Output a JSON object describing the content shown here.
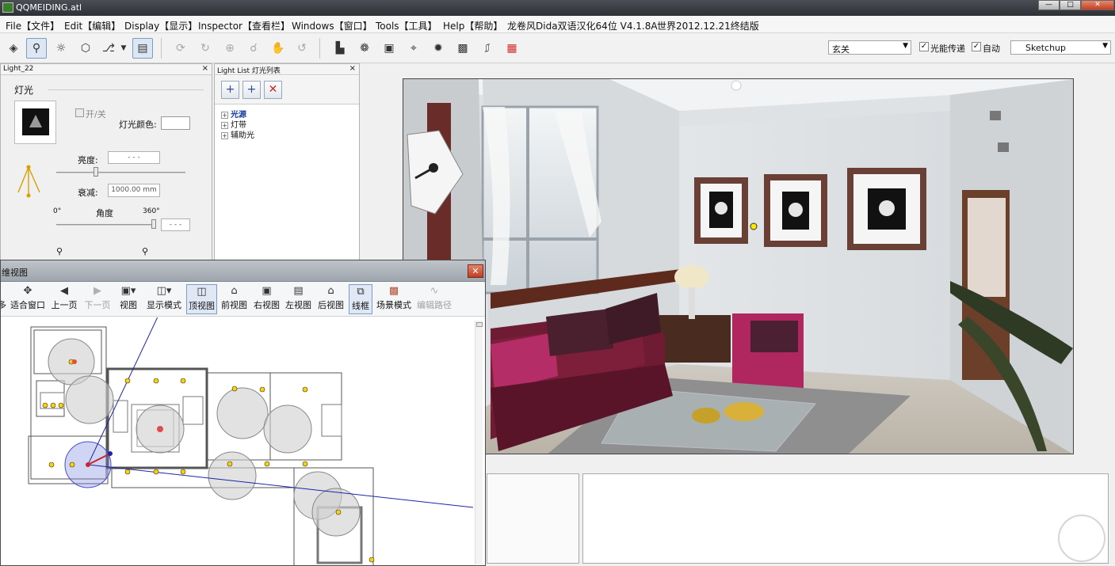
{
  "window": {
    "title": "QQMEIDING.atl",
    "controls": {
      "minimize": "—",
      "maximize": "□",
      "close": "✕"
    }
  },
  "menu": [
    {
      "label": "File【文件】"
    },
    {
      "label": "Edit【编辑】"
    },
    {
      "label": "Display【显示】"
    },
    {
      "label": "Inspector【查看栏】"
    },
    {
      "label": "Windows【窗口】"
    },
    {
      "label": "Tools【工具】"
    },
    {
      "label": "Help【帮助】"
    },
    {
      "label": "龙卷风Dida双语汉化64位 V4.1.8A"
    },
    {
      "label": "世界2012.12.21终结版"
    }
  ],
  "toolbar": {
    "icons_left": [
      "paint-bucket",
      "light",
      "sun",
      "cube",
      "cursor",
      "dropdown",
      "panel"
    ],
    "icons_mid": [
      "rotate",
      "walk",
      "zoom-region",
      "zoom",
      "hand",
      "orbit"
    ],
    "icons_right": [
      "import",
      "materials",
      "render",
      "crop",
      "settings",
      "image",
      "export",
      "capture"
    ],
    "style_select": {
      "value": "玄关"
    },
    "photometric": {
      "label": "光能传递",
      "checked": true
    },
    "auto": {
      "label": "自动",
      "checked": true
    },
    "sketchup_select": {
      "value": "Sketchup"
    }
  },
  "light_panel": {
    "tab": "Light_22",
    "close": "×",
    "section": "灯光",
    "toggle_label": "开/关",
    "color_label": "灯光颜色:",
    "brightness_label": "亮度:",
    "brightness_value": "- - -",
    "brightness_level": 0.3,
    "attenuation_label": "衰减:",
    "attenuation_value": "1000.00 mm",
    "angle_label": "角度",
    "angle_min": "0°",
    "angle_max": "360°",
    "angle_value": "- - -",
    "angle_level": 1.0
  },
  "light_list": {
    "title": "Light List 灯光列表",
    "close": "×",
    "buttons": {
      "add_group": "+",
      "add": "+",
      "delete": "✕"
    },
    "items": [
      {
        "label": "光源",
        "selected": true
      },
      {
        "label": "灯带",
        "selected": false
      },
      {
        "label": "辅助光",
        "selected": false
      }
    ]
  },
  "floorplan": {
    "title": "维视图",
    "close": "✕",
    "buttons": [
      {
        "label": "多",
        "icon": "move-icon",
        "active": false,
        "disabled": false
      },
      {
        "label": "适合窗口",
        "icon": "fit-window-icon",
        "active": false,
        "disabled": false
      },
      {
        "label": "上一页",
        "icon": "arrow-left-icon",
        "active": false,
        "disabled": false
      },
      {
        "label": "下一页",
        "icon": "arrow-right-icon",
        "active": false,
        "disabled": true
      },
      {
        "label": "视图",
        "icon": "view-icon",
        "active": false,
        "disabled": false
      },
      {
        "label": "显示模式",
        "icon": "display-mode-icon",
        "active": false,
        "disabled": false
      },
      {
        "label": "顶视图",
        "icon": "top-view-icon",
        "active": true,
        "disabled": false
      },
      {
        "label": "前视图",
        "icon": "front-view-icon",
        "active": false,
        "disabled": false
      },
      {
        "label": "右视图",
        "icon": "right-view-icon",
        "active": false,
        "disabled": false
      },
      {
        "label": "左视图",
        "icon": "left-view-icon",
        "active": false,
        "disabled": false
      },
      {
        "label": "后视图",
        "icon": "back-view-icon",
        "active": false,
        "disabled": false
      },
      {
        "label": "线框",
        "icon": "wireframe-icon",
        "active": true,
        "disabled": false
      },
      {
        "label": "场景模式",
        "icon": "scene-mode-icon",
        "active": false,
        "disabled": false
      },
      {
        "label": "编辑路径",
        "icon": "edit-path-icon",
        "active": false,
        "disabled": true
      }
    ]
  },
  "colors": {
    "accent": "#7c9cc4",
    "wall": "#eceff1",
    "sofa": "#7d1f3a",
    "close": "#c33f22"
  }
}
